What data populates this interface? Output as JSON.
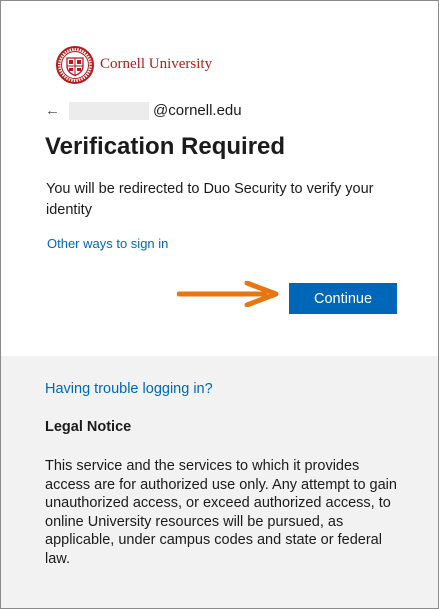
{
  "brand": {
    "name": "Cornell University",
    "color": "#b31b1b",
    "seal_icon": "cornell-seal-icon"
  },
  "identity": {
    "back_icon": "arrow-left-icon",
    "email_domain": "@cornell.edu"
  },
  "main": {
    "title": "Verification Required",
    "description": "You will be redirected to Duo Security to verify your identity",
    "other_ways_link": "Other ways to sign in",
    "continue_label": "Continue"
  },
  "annotation": {
    "icon": "arrow-right-icon",
    "color": "#e8750f"
  },
  "footer": {
    "trouble_link": "Having trouble logging in?",
    "legal_heading": "Legal Notice",
    "legal_body": "This service and the services to which it provides access are for authorized use only. Any attempt to gain unauthorized access, or exceed authorized access, to online University resources will be pursued, as applicable, under campus codes and state or federal law."
  },
  "colors": {
    "accent": "#0067b8",
    "footer_bg": "#f2f2f2",
    "text": "#1b1b1b"
  }
}
